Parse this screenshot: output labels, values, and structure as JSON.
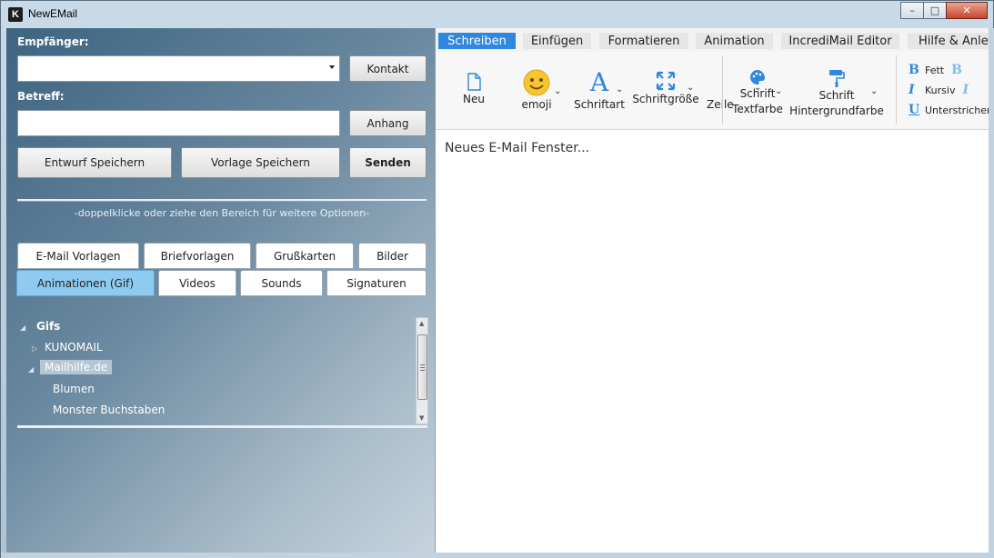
{
  "window": {
    "title": "NewEMail",
    "icon_letter": "K",
    "controls": {
      "minimize": "–",
      "maximize": "□",
      "close": "✕"
    }
  },
  "compose": {
    "recipient_label": "Empfänger:",
    "recipient_value": "",
    "contact_button": "Kontakt",
    "subject_label": "Betreff:",
    "subject_value": "",
    "attach_button": "Anhang",
    "save_draft_button": "Entwurf Speichern",
    "save_template_button": "Vorlage Speichern",
    "send_button": "Senden",
    "hint": "-doppelklicke oder ziehe den Bereich für weitere Optionen-"
  },
  "library": {
    "tabs_row1": [
      "E-Mail Vorlagen",
      "Briefvorlagen",
      "Grußkarten",
      "Bilder"
    ],
    "tabs_row2": [
      "Animationen (Gif)",
      "Videos",
      "Sounds",
      "Signaturen"
    ],
    "active_tab": "Animationen (Gif)",
    "tree": [
      {
        "label": "Gifs",
        "level": 0,
        "expanded": true
      },
      {
        "label": "KUNOMAIL",
        "level": 1,
        "expanded": false
      },
      {
        "label": "Mailhilfe.de",
        "level": 1,
        "expanded": true,
        "selected": true
      },
      {
        "label": "Blumen",
        "level": 2
      },
      {
        "label": "Monster Buchstaben",
        "level": 2
      }
    ]
  },
  "ribbon": {
    "tabs": [
      "Schreiben",
      "Einfügen",
      "Formatieren",
      "Animation",
      "IncrediMail Editor",
      "Hilfe & Anle"
    ],
    "active_tab": "Schreiben",
    "items": {
      "new": "Neu",
      "emoji": "emoji",
      "font": "Schriftart",
      "font_size": "Schriftgröße",
      "line": "Zeile",
      "text_color_1": "Schrift",
      "text_color_2": "Textfarbe",
      "bg_color_1": "Schrift",
      "bg_color_2": "Hintergrundfarbe",
      "bold": "Fett",
      "italic": "Kursiv",
      "underline": "Unterstrichen"
    }
  },
  "editor": {
    "text": "Neues E-Mail Fenster..."
  },
  "colors": {
    "accent": "#2f88e0",
    "active_library_tab": "#8fcbf0"
  }
}
